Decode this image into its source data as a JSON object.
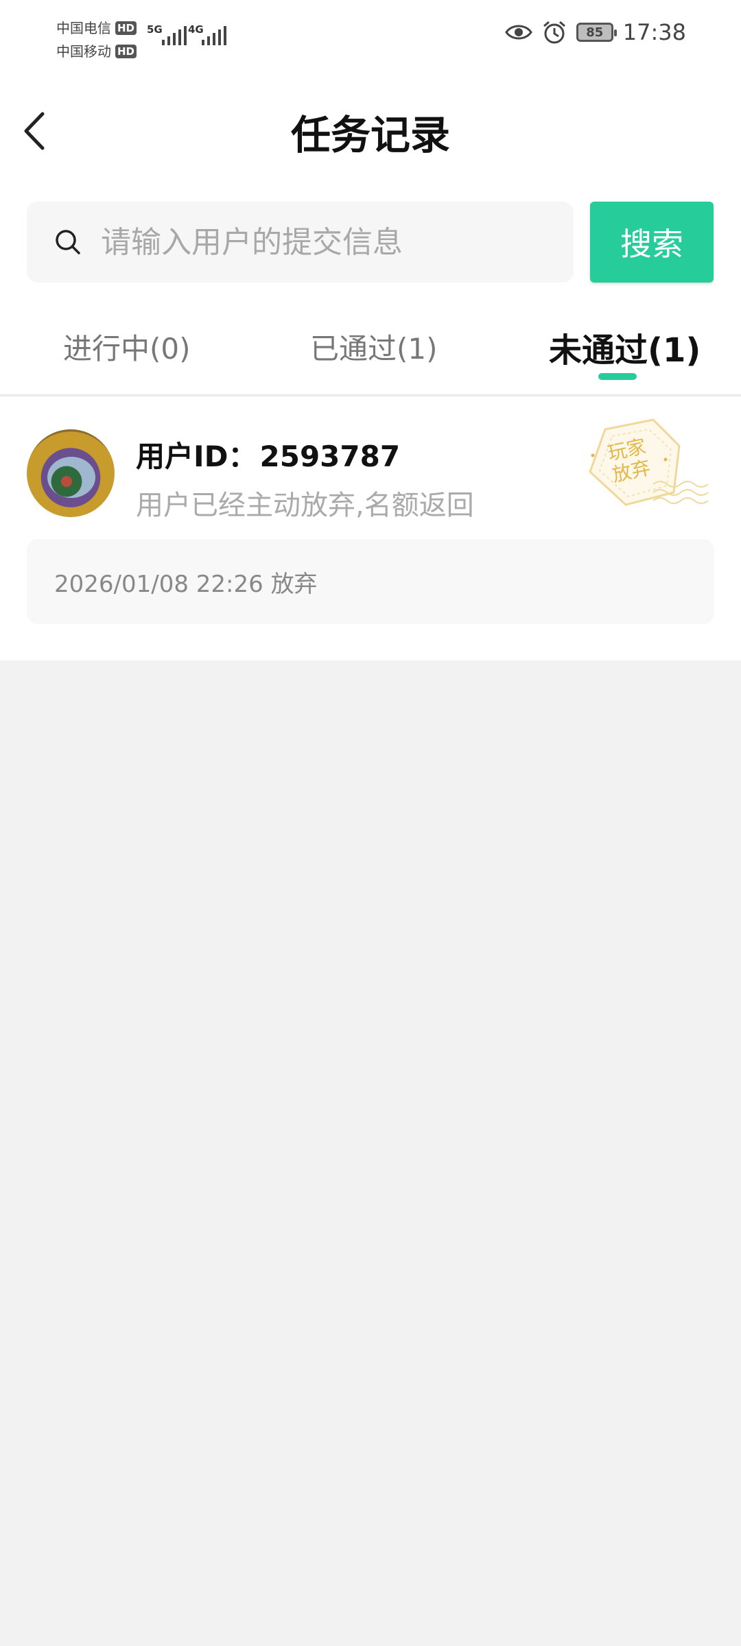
{
  "status_bar": {
    "carrier1": "中国电信",
    "carrier2": "中国移动",
    "hd": "HD",
    "net1": "5G",
    "net2": "4G",
    "battery": "85",
    "time": "17:38"
  },
  "header": {
    "title": "任务记录",
    "back_icon": "chevron-left-icon"
  },
  "search": {
    "placeholder": "请输入用户的提交信息",
    "value": "",
    "button_label": "搜索"
  },
  "tabs": [
    {
      "label": "进行中(0)",
      "active": false
    },
    {
      "label": "已通过(1)",
      "active": false
    },
    {
      "label": "未通过(1)",
      "active": true
    }
  ],
  "records": [
    {
      "user_id_label": "用户ID：",
      "user_id": "2593787",
      "status_text": "用户已经主动放弃,名额返回",
      "stamp_line1": "玩家",
      "stamp_line2": "放弃",
      "time": "2026/01/08 22:26 放弃"
    }
  ],
  "colors": {
    "accent": "#26cc9a",
    "stamp": "#e3b84a",
    "background": "#f2f2f2"
  }
}
